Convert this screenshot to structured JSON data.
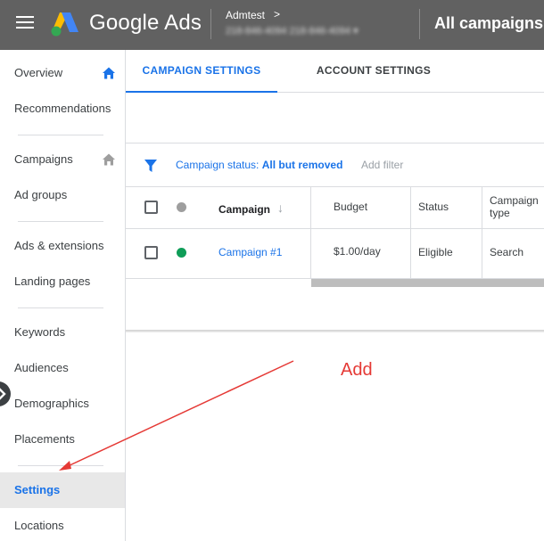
{
  "header": {
    "brand": "Google Ads",
    "account_name": "Admtest",
    "account_chevron": ">",
    "account_id_blurred": "218-846-4094  218-846-4094 ▾",
    "page_title": "All campaigns",
    "menu_icon": "hamburger-menu-icon",
    "logo_icon": "google-ads-logo"
  },
  "sidebar": {
    "items": [
      {
        "label": "Overview",
        "icon": "home-icon"
      },
      {
        "label": "Recommendations"
      },
      {
        "label": "Campaigns",
        "icon": "home-icon"
      },
      {
        "label": "Ad groups"
      },
      {
        "label": "Ads & extensions"
      },
      {
        "label": "Landing pages"
      },
      {
        "label": "Keywords"
      },
      {
        "label": "Audiences"
      },
      {
        "label": "Demographics"
      },
      {
        "label": "Placements"
      },
      {
        "label": "Settings",
        "active": true
      },
      {
        "label": "Locations"
      }
    ],
    "active_color": "#1a73e8"
  },
  "tabs": [
    {
      "label": "CAMPAIGN SETTINGS",
      "active": true
    },
    {
      "label": "ACCOUNT SETTINGS",
      "active": false
    }
  ],
  "filter": {
    "label_prefix": "Campaign status: ",
    "label_value": "All but removed",
    "add_filter": "Add filter",
    "icon": "filter-funnel-icon"
  },
  "table": {
    "columns": [
      "Campaign",
      "Budget",
      "Status",
      "Campaign type"
    ],
    "sort_indicator": "↓",
    "rows": [
      {
        "status_dot": "#0f9d58",
        "campaign": "Campaign #1",
        "budget": "$1.00/day",
        "status": "Eligible",
        "type": "Search"
      }
    ],
    "header_dot_color": "#9e9e9e"
  },
  "annotation": {
    "text": "Add",
    "color": "#e53935"
  }
}
